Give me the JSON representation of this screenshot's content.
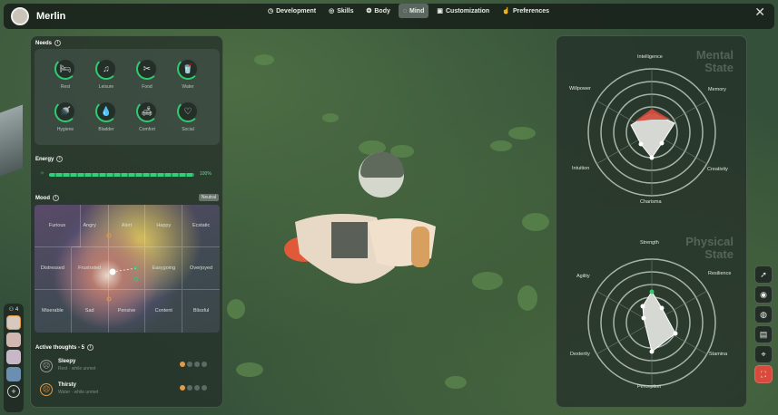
{
  "header": {
    "character_name": "Merlin",
    "tabs": [
      {
        "label": "Development",
        "icon": "clock-icon"
      },
      {
        "label": "Skills",
        "icon": "target-icon"
      },
      {
        "label": "Body",
        "icon": "brain-icon"
      },
      {
        "label": "Mind",
        "icon": "mind-icon",
        "active": true
      },
      {
        "label": "Customization",
        "icon": "shirt-icon"
      },
      {
        "label": "Preferences",
        "icon": "thumbs-up-icon"
      }
    ],
    "close": "✕"
  },
  "needs": {
    "title": "Needs",
    "items": [
      {
        "label": "Rest",
        "icon": "🛏"
      },
      {
        "label": "Leisure",
        "icon": "♫"
      },
      {
        "label": "Food",
        "icon": "✂"
      },
      {
        "label": "Water",
        "icon": "🥤"
      },
      {
        "label": "Hygiene",
        "icon": "🚿"
      },
      {
        "label": "Bladder",
        "icon": "💧"
      },
      {
        "label": "Comfort",
        "icon": "🛋"
      },
      {
        "label": "Social",
        "icon": "♡"
      }
    ]
  },
  "energy": {
    "title": "Energy",
    "value": "100%",
    "level": 1.0
  },
  "mood": {
    "title": "Mood",
    "badge": "Neutral",
    "cells": [
      "Furious",
      "Angry",
      "Alert",
      "Happy",
      "Ecstatic",
      "Distressed",
      "Frustrated",
      "",
      "Easygoing",
      "Overjoyed",
      "Miserable",
      "Sad",
      "Pensive",
      "Content",
      "Blissful"
    ]
  },
  "thoughts": {
    "title": "Active thoughts - 5",
    "items": [
      {
        "name": "Sleepy",
        "sub": "Rest · while unmet",
        "face": "☹"
      },
      {
        "name": "Thirsty",
        "sub": "Water · while unmet",
        "face": "☹"
      }
    ]
  },
  "mental": {
    "title_1": "Mental",
    "title_2": "State",
    "labels": [
      "Intelligence",
      "Memory",
      "Creativity",
      "Charisma",
      "Intuition",
      "Willpower"
    ]
  },
  "physical": {
    "title_1": "Physical",
    "title_2": "State",
    "labels": [
      "Strength",
      "Resilience",
      "Stamina",
      "Perception",
      "Dexterity",
      "Agility"
    ]
  },
  "roster": {
    "count": "4",
    "badge_1": "+",
    "badge_2": "!"
  },
  "colors": {
    "accent_green": "#2ecc71",
    "warning_orange": "#e59a45",
    "danger_red": "#d94a3c"
  }
}
